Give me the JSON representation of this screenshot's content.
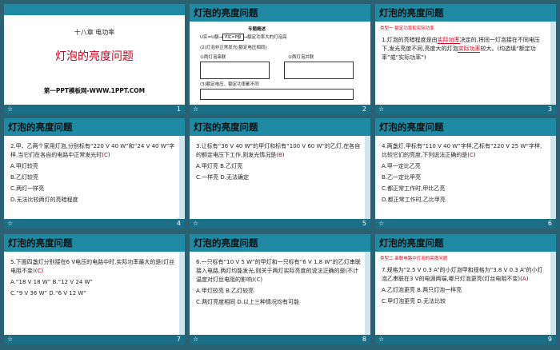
{
  "brand": {
    "header_color": "#1e8aa4",
    "footer_color": "#1a6f86",
    "answer_color": "#d0021b",
    "bg": "#2a6273"
  },
  "slides": [
    {
      "num": "1",
      "chapter": "十八章  电功率",
      "title": "灯泡的亮度问题",
      "site": "第一PPT模板网-WWW.1PPT.COM"
    },
    {
      "num": "2",
      "header": "灯泡的亮度问题",
      "subtitle": "专题概述",
      "l1": "U实=U额→",
      "b1": "P实=P额",
      "l1b": "→额定功率大的灯泡亮",
      "l2": "(2)灯泡非正常发光(额定电压相同)",
      "l3a": "①两灯泡串联",
      "l3b": "②两灯泡并联",
      "l4": "(3)额定电压、额定功率都不同"
    },
    {
      "num": "3",
      "header": "灯泡的亮度问题",
      "tag": "类型一  额定功率和实际功率",
      "q": "1.灯泡的亮暗程度是由",
      "a1": "实际功率",
      "q2": "决定的,将同一灯泡接在不同电压下,发光亮度不同,亮度大的灯泡",
      "a2": "实际功率",
      "q3": "较大。(均选填“额定功率”或“实际功率”)"
    },
    {
      "num": "4",
      "header": "灯泡的亮度问题",
      "q": "2.甲、乙两个家用灯泡,分别标有“220 V  40 W”和“24 V  40 W”字样,当它们在各自的电路中正常发光时(",
      "ans": "C",
      "q_end": ")",
      "options": [
        "A.甲灯较亮",
        "B.乙灯较亮",
        "C.两灯一样亮",
        "D.无法比较两灯的亮暗程度"
      ]
    },
    {
      "num": "5",
      "header": "灯泡的亮度问题",
      "q": "3.让标有“36 V  40 W”的甲灯和标有“100 V  60 W”的乙灯,在各自的额定电压下工作,则发光情况是(",
      "ans": "B",
      "q_end": ")",
      "options": [
        "A.甲灯亮  B.乙灯亮",
        "C.一样亮  D.无法确定"
      ]
    },
    {
      "num": "6",
      "header": "灯泡的亮度问题",
      "q": "4.两盏灯,甲标有“110 V  40 W”字样,乙标有“220 V  25 W”字样,比较它们的亮度,下列说法正确的是(",
      "ans": "C",
      "q_end": ")",
      "options": [
        "A.甲一定比乙亮",
        "B.乙一定比甲亮",
        "C.都正常工作时,甲比乙亮",
        "D.都正常工作时,乙比甲亮"
      ]
    },
    {
      "num": "7",
      "header": "灯泡的亮度问题",
      "q": "5.下面四盏灯分别接在6 V电压的电路中时,实际功率最大的是(灯丝电阻不变)(",
      "ans": "C",
      "q_end": ")",
      "options": [
        "A.“18 V  18 W”  B.“12 V  24 W”",
        "C.“9 V  36 W”   D.“6 V  12 W”"
      ]
    },
    {
      "num": "8",
      "header": "灯泡的亮度问题",
      "q": "6.一只标有“10 V  5 W”的甲灯和一只标有“6 V  1.8 W”的乙灯串联接入电路,两灯均能发光,则关于两灯实际亮度的说法正确的是(不计温度对灯丝电阻的影响)(",
      "ans": "C",
      "q_end": ")",
      "options": [
        "A.甲灯较亮       B.乙灯较亮",
        "C.两灯亮度相同   D.以上三种情况均有可能"
      ]
    },
    {
      "num": "9",
      "header": "灯泡的亮度问题",
      "tag": "类型二  串联电路中灯泡的亮度问题",
      "q": "7.规格为“2.5 V  0.3 A”的小灯泡甲和规格为“3.8 V  0.3 A”的小灯泡乙串联在3 V的电源两端,哪只灯泡更亮(灯丝电阻不变)(",
      "ans": "A",
      "q_end": ")",
      "options": [
        "A.乙灯泡更亮  B.两只灯泡一样亮",
        "C.甲灯泡更亮  D.无法比较"
      ]
    }
  ]
}
